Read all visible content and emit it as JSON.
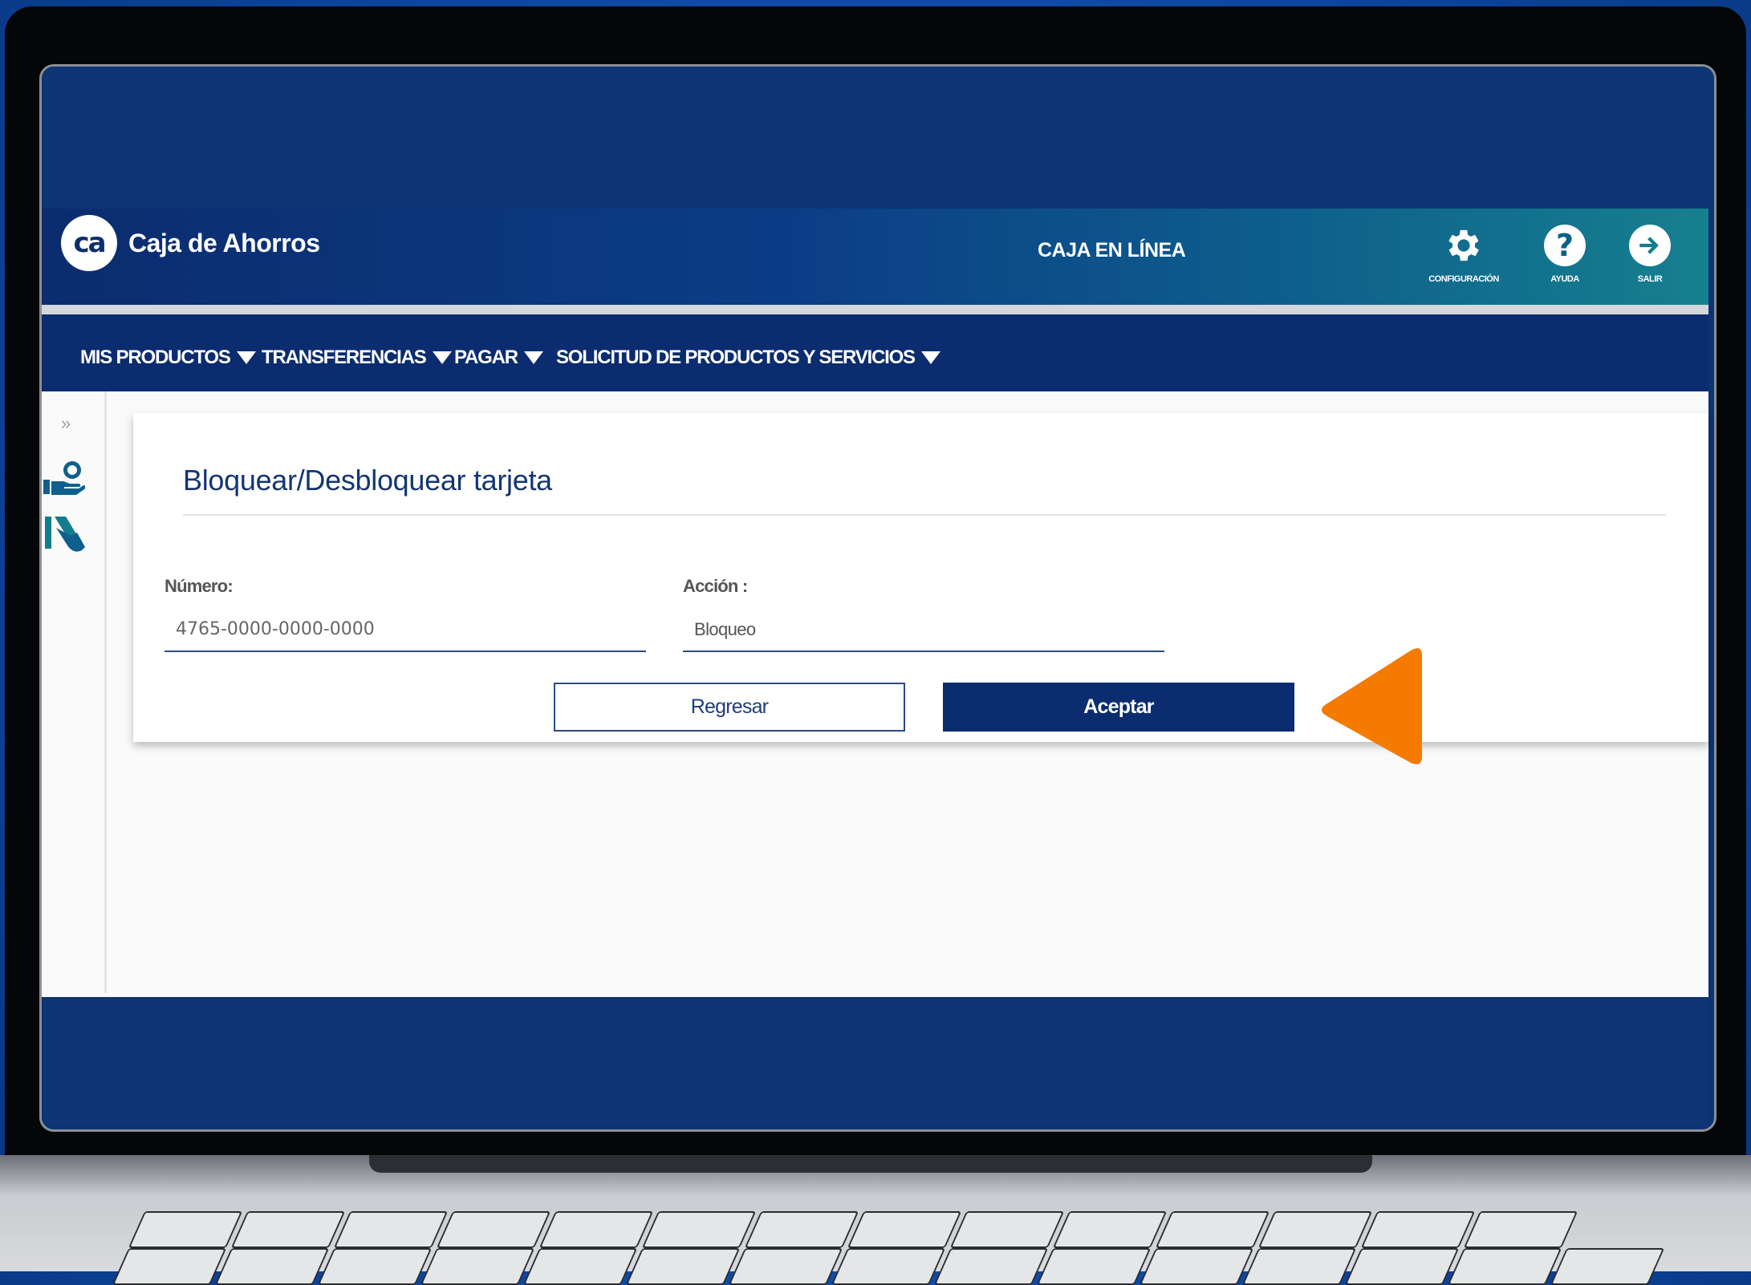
{
  "header": {
    "logo_text": "ca",
    "brand_name": "Caja de Ahorros",
    "center_title": "CAJA EN LÍNEA",
    "icons": [
      {
        "name": "gear-icon",
        "label": "CONFIGURACIÓN"
      },
      {
        "name": "help-icon",
        "label": "AYUDA"
      },
      {
        "name": "exit-icon",
        "label": "SALIR"
      }
    ]
  },
  "nav": {
    "items": [
      "MIS PRODUCTOS",
      "TRANSFERENCIAS",
      "PAGAR",
      "SOLICITUD DE PRODUCTOS Y SERVICIOS"
    ]
  },
  "sidebar": {
    "expand": "»",
    "icons": [
      "hand-money-icon",
      "card-hand-icon"
    ]
  },
  "form": {
    "title": "Bloquear/Desbloquear tarjeta",
    "numero_label": "Número:",
    "numero_value": "4765-0000-0000-0000",
    "accion_label": "Acción :",
    "accion_value": "Bloqueo",
    "back_button": "Regresar",
    "accept_button": "Aceptar"
  },
  "colors": {
    "brand_navy": "#0b2c6e",
    "header_teal": "#16808f",
    "pointer_orange": "#f47b00"
  }
}
